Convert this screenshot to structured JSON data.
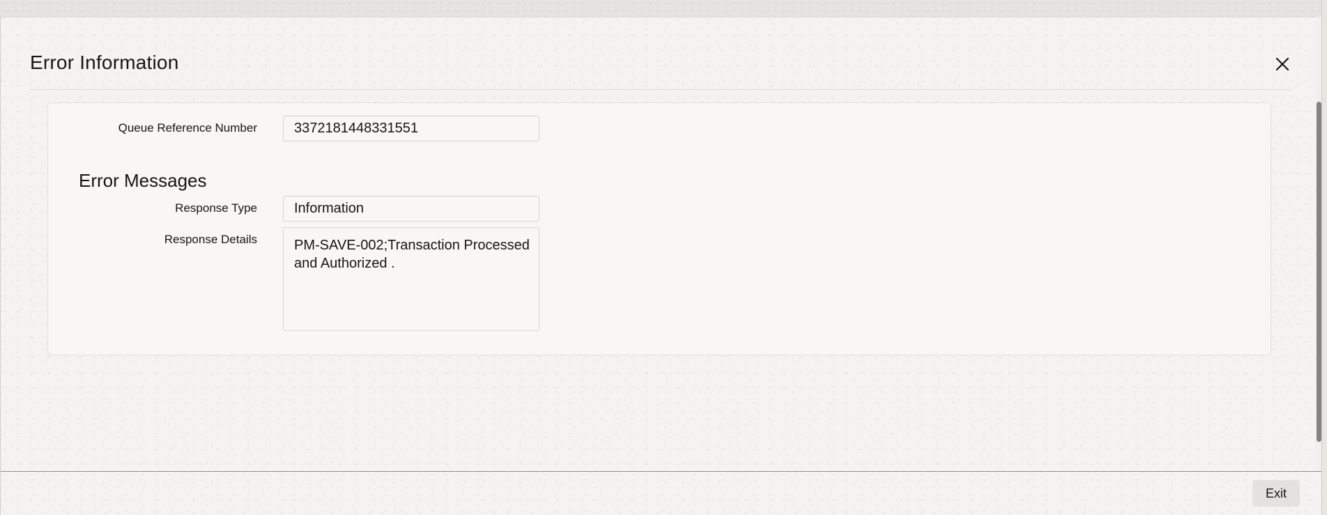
{
  "dialog": {
    "title": "Error Information",
    "close_icon": "close-icon",
    "exit_label": "Exit"
  },
  "form": {
    "queue_reference": {
      "label": "Queue Reference Number",
      "value": "3372181448331551"
    },
    "error_messages_heading": "Error Messages",
    "response_type": {
      "label": "Response Type",
      "value": "Information"
    },
    "response_details": {
      "label": "Response Details",
      "value": "PM-SAVE-002;Transaction Processed and Authorized ."
    }
  }
}
